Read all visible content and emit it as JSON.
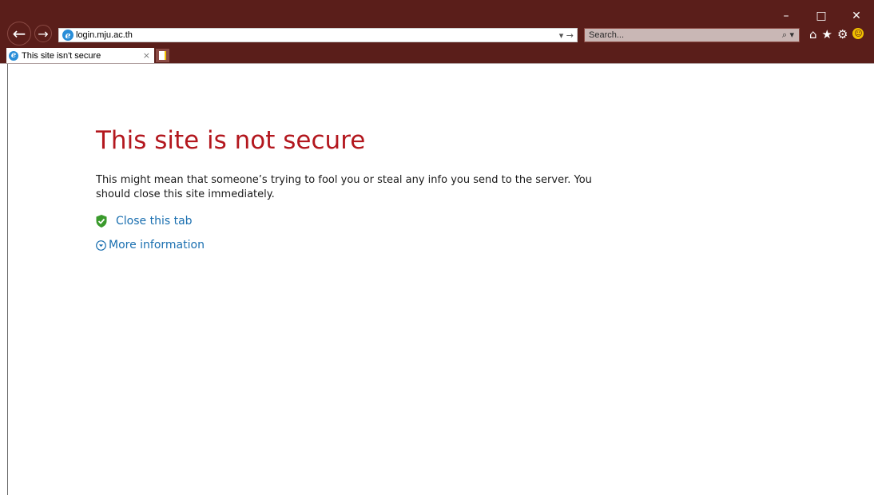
{
  "window": {
    "minimize_glyph": "–",
    "maximize_glyph": "□",
    "close_glyph": "✕"
  },
  "toolbar": {
    "back_glyph": "←",
    "forward_glyph": "→",
    "address_url": "login.mju.ac.th",
    "address_dropdown": "▾ →",
    "search_placeholder": "Search...",
    "search_glyph": "⌕ ▾",
    "home_glyph": "⌂",
    "favorites_glyph": "★",
    "settings_glyph": "⚙",
    "feedback_glyph": "☺"
  },
  "tabs": [
    {
      "label": "This site isn't secure",
      "close_glyph": "×"
    }
  ],
  "colors": {
    "chrome": "#5a1e1a",
    "headline": "#b3171e",
    "link": "#1a6fb0",
    "shield": "#3a9a2c"
  },
  "page": {
    "headline": "This site is not secure",
    "description": "This might mean that someone’s trying to fool you or steal any info you send to the server. You should close this site immediately.",
    "close_tab_label": "Close this tab",
    "more_info_label": "More information"
  }
}
